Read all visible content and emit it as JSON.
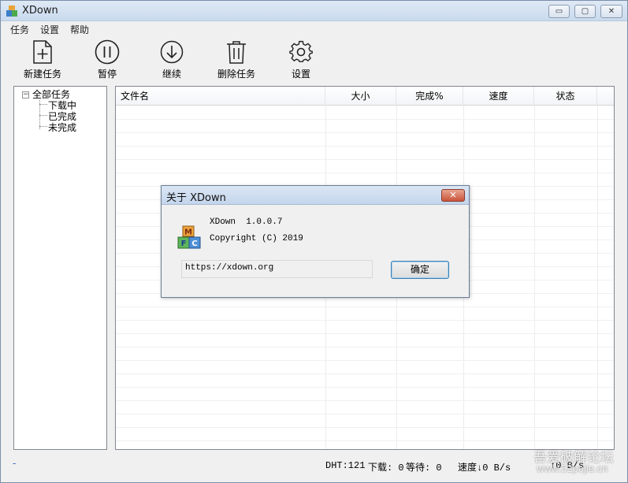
{
  "window": {
    "title": "XDown",
    "controls": {
      "minimize": "▭",
      "maximize": "▢",
      "close": "✕"
    }
  },
  "menu": [
    "任务",
    "设置",
    "帮助"
  ],
  "toolbar": [
    {
      "label": "新建任务",
      "icon": "new-task-icon"
    },
    {
      "label": "暂停",
      "icon": "pause-icon"
    },
    {
      "label": "继续",
      "icon": "resume-icon"
    },
    {
      "label": "删除任务",
      "icon": "trash-icon"
    },
    {
      "label": "设置",
      "icon": "gear-icon"
    }
  ],
  "tree": {
    "root": "全部任务",
    "expander": "−",
    "children": [
      "下载中",
      "已完成",
      "未完成"
    ]
  },
  "list": {
    "columns": [
      "文件名",
      "大小",
      "完成%",
      "速度",
      "状态"
    ]
  },
  "status": {
    "left": "-",
    "dht": "DHT:121",
    "downloading": "下载: 0",
    "waiting": "等待: 0",
    "speed_down": "速度↓0 B/s",
    "speed_up": "↑0 B/s"
  },
  "watermark": {
    "main": "吾爱破解论坛",
    "sub": "www.52pojie.cn"
  },
  "about_dialog": {
    "title": "关于 XDown",
    "close": "✕",
    "icon_letters": [
      "M",
      "F",
      "C"
    ],
    "app_line": "XDown  1.0.0.7",
    "copyright": "Copyright (C) 2019",
    "url": "https://xdown.org",
    "ok_label": "确定"
  },
  "colors": {
    "accent": "#3c7fb1",
    "titlebar": "#c9daee",
    "close_red": "#c9543a"
  }
}
